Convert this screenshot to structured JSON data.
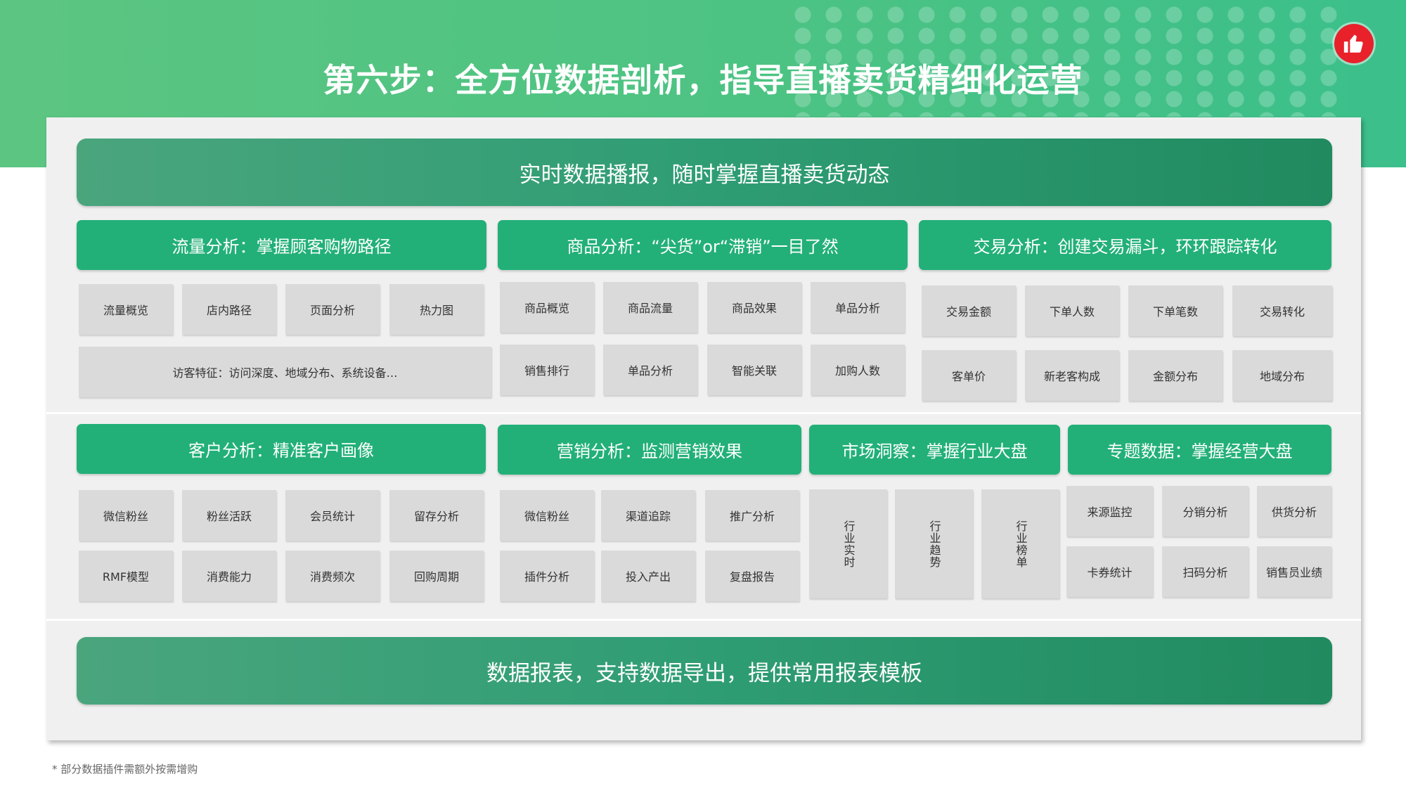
{
  "title": "第六步：全方位数据剖析，指导直播卖货精细化运营",
  "colors": {
    "accent_green": "#22b078",
    "dark_green": "#2f9d74",
    "like_red": "#e8212b"
  },
  "icons": {
    "like": "thumbs-up-icon"
  },
  "top_bar": "实时数据播报，随时掌握直播卖货动态",
  "bottom_bar": "数据报表，支持数据导出，提供常用报表模板",
  "footnote": "* 部分数据插件需额外按需增购",
  "traffic": {
    "header": "流量分析：掌握顾客购物路径",
    "items": [
      "流量概览",
      "店内路径",
      "页面分析",
      "热力图"
    ],
    "wide": "访客特征：访问深度、地域分布、系统设备…"
  },
  "product": {
    "header": "商品分析：“尖货”or“滞销”一目了然",
    "items": [
      "商品概览",
      "商品流量",
      "商品效果",
      "单品分析",
      "销售排行",
      "单品分析",
      "智能关联",
      "加购人数"
    ]
  },
  "trade": {
    "header": "交易分析：创建交易漏斗，环环跟踪转化",
    "items": [
      "交易金额",
      "下单人数",
      "下单笔数",
      "交易转化",
      "客单价",
      "新老客构成",
      "金额分布",
      "地域分布"
    ]
  },
  "customer": {
    "header": "客户分析：精准客户画像",
    "items": [
      "微信粉丝",
      "粉丝活跃",
      "会员统计",
      "留存分析",
      "RMF模型",
      "消费能力",
      "消费频次",
      "回购周期"
    ]
  },
  "marketing": {
    "header": "营销分析：监测营销效果",
    "items": [
      "微信粉丝",
      "渠道追踪",
      "推广分析",
      "插件分析",
      "投入产出",
      "复盘报告"
    ]
  },
  "market": {
    "header": "市场洞察：掌握行业大盘",
    "items": [
      "行业实时",
      "行业趋势",
      "行业榜单"
    ]
  },
  "special": {
    "header": "专题数据：掌握经营大盘",
    "items": [
      "来源监控",
      "分销分析",
      "供货分析",
      "卡券统计",
      "扫码分析",
      "销售员业绩"
    ]
  }
}
